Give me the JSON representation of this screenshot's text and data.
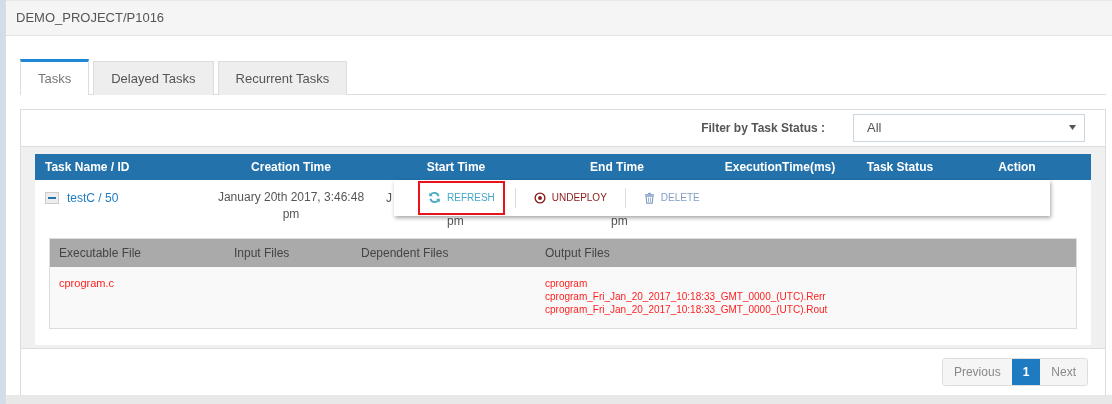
{
  "breadcrumb": "DEMO_PROJECT/P1016",
  "tabs": [
    {
      "label": "Tasks",
      "selected": true
    },
    {
      "label": "Delayed Tasks",
      "selected": false
    },
    {
      "label": "Recurrent Tasks",
      "selected": false
    }
  ],
  "filter": {
    "label": "Filter by Task Status :",
    "value": "All"
  },
  "table": {
    "columns": [
      "Task Name / ID",
      "Creation Time",
      "Start Time",
      "End Time",
      "ExecutionTime(ms)",
      "Task Status",
      "Action"
    ],
    "rows": [
      {
        "expanded": true,
        "name": "testC / 50",
        "creation_time": "January 20th 2017, 3:46:48 pm",
        "start_time": [
          "J",
          "pm"
        ],
        "end_time": [
          "pm"
        ],
        "details": {
          "columns": [
            "Executable File",
            "Input Files",
            "Dependent Files",
            "Output Files"
          ],
          "executable": [
            "cprogram.c"
          ],
          "outputs": [
            "cprogram",
            "cprogram_Fri_Jan_20_2017_10:18:33_GMT_0000_(UTC).Rerr",
            "cprogram_Fri_Jan_20_2017_10:18:33_GMT_0000_(UTC).Rout"
          ]
        }
      }
    ]
  },
  "action_menu": [
    {
      "kind": "refresh",
      "label": "REFRESH",
      "highlighted": true
    },
    {
      "kind": "undeploy",
      "label": "UNDEPLOY",
      "highlighted": false
    },
    {
      "kind": "delete",
      "label": "DELETE",
      "highlighted": false
    }
  ],
  "pagination": [
    {
      "label": "Previous",
      "selected": false
    },
    {
      "label": "1",
      "selected": true
    },
    {
      "label": "Next",
      "selected": false
    }
  ]
}
